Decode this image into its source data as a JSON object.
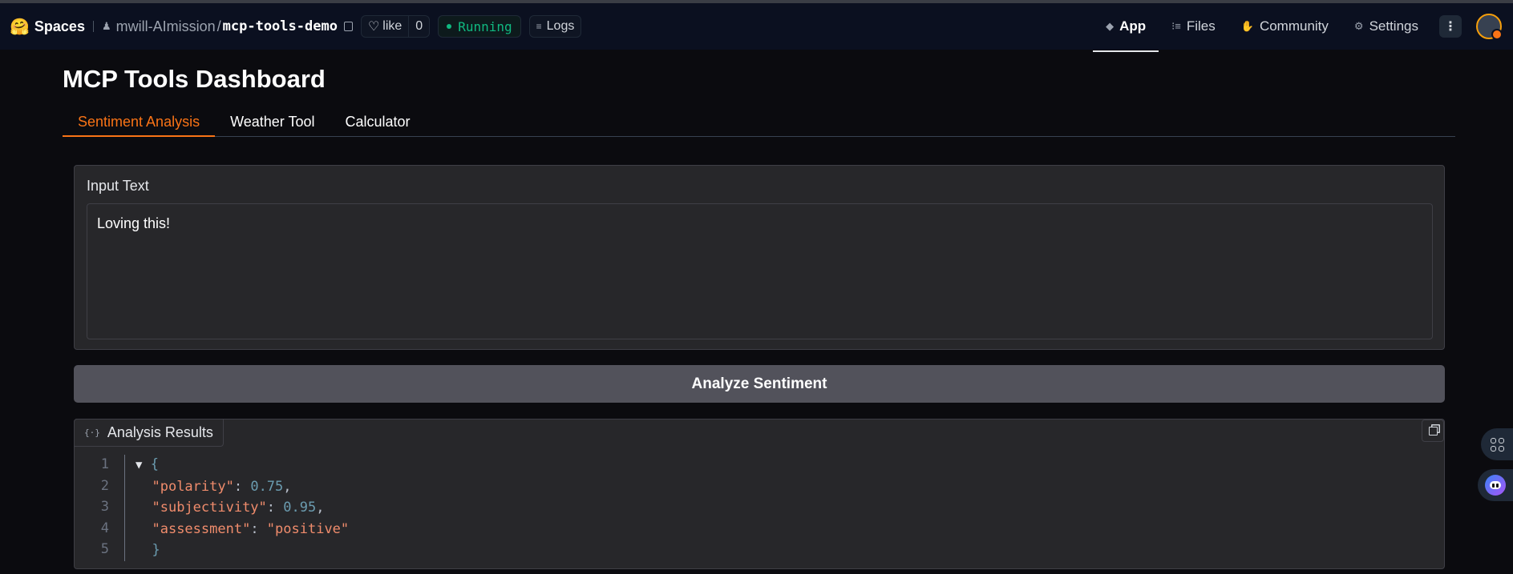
{
  "topbar": {
    "brand": "Spaces",
    "owner": "mwill-AImission",
    "repo": "mcp-tools-demo",
    "like_label": "like",
    "like_count": "0",
    "status": "Running",
    "logs_label": "Logs",
    "nav": [
      {
        "label": "App",
        "icon": "cube-icon",
        "active": true
      },
      {
        "label": "Files",
        "icon": "files-icon",
        "active": false
      },
      {
        "label": "Community",
        "icon": "community-icon",
        "active": false
      },
      {
        "label": "Settings",
        "icon": "gear-icon",
        "active": false
      }
    ]
  },
  "page": {
    "title": "MCP Tools Dashboard",
    "tabs": [
      {
        "label": "Sentiment Analysis",
        "active": true
      },
      {
        "label": "Weather Tool",
        "active": false
      },
      {
        "label": "Calculator",
        "active": false
      }
    ]
  },
  "input": {
    "label": "Input Text",
    "value": "Loving this!"
  },
  "button": {
    "label": "Analyze Sentiment"
  },
  "results": {
    "label": "Analysis Results",
    "line_numbers": [
      "1",
      "2",
      "3",
      "4",
      "5"
    ],
    "json": {
      "open": "{",
      "close": "}",
      "entries": [
        {
          "key": "\"polarity\"",
          "value": "0.75",
          "trail": ","
        },
        {
          "key": "\"subjectivity\"",
          "value": "0.95",
          "trail": ","
        },
        {
          "key": "\"assessment\"",
          "value": "\"positive\"",
          "trail": ""
        }
      ]
    }
  },
  "colors": {
    "accent": "#f97316",
    "running": "#10b981",
    "json_key": "#f08c6c",
    "json_number": "#6b9cb0"
  }
}
